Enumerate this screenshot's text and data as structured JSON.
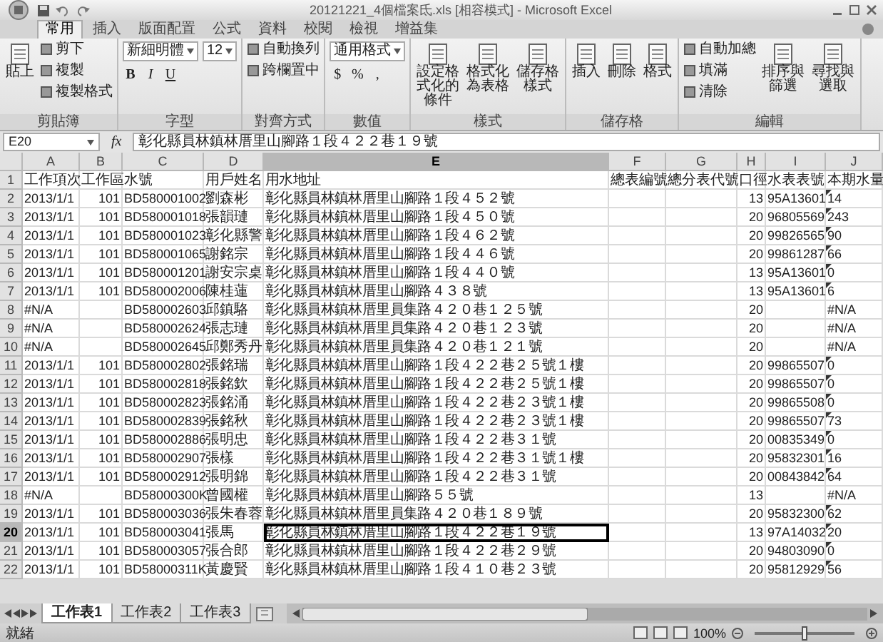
{
  "window": {
    "title": "20121221_4個檔案氐.xls [相容模式] - Microsoft Excel"
  },
  "ribbon_tabs": [
    {
      "label": "常用",
      "selected": true
    },
    {
      "label": "插入",
      "selected": false
    },
    {
      "label": "版面配置",
      "selected": false
    },
    {
      "label": "公式",
      "selected": false
    },
    {
      "label": "資料",
      "selected": false
    },
    {
      "label": "校閱",
      "selected": false
    },
    {
      "label": "檢視",
      "selected": false
    },
    {
      "label": "增益集",
      "selected": false
    }
  ],
  "ribbon_groups": [
    {
      "label": "剪貼簿",
      "parts": [
        {
          "kind": "large",
          "label": "貼上"
        },
        {
          "kind": "stack",
          "lines": [
            [
              {
                "kind": "small",
                "label": "剪下"
              }
            ],
            [
              {
                "kind": "small",
                "label": "複製"
              }
            ],
            [
              {
                "kind": "small",
                "label": "複製格式"
              }
            ]
          ]
        }
      ]
    },
    {
      "label": "字型",
      "parts": [
        {
          "kind": "stack",
          "lines": [
            [
              {
                "kind": "dropdown",
                "label": "新細明體"
              },
              {
                "kind": "dropdown",
                "label": "12"
              }
            ],
            [
              {
                "kind": "char",
                "label": "B"
              },
              {
                "kind": "char",
                "label": "I"
              },
              {
                "kind": "char",
                "label": "U"
              }
            ]
          ]
        }
      ]
    },
    {
      "label": "對齊方式",
      "parts": [
        {
          "kind": "stack",
          "lines": [
            [
              {
                "kind": "small",
                "label": "自動換列"
              }
            ],
            [
              {
                "kind": "small",
                "label": "跨欄置中"
              }
            ]
          ]
        }
      ]
    },
    {
      "label": "數值",
      "parts": [
        {
          "kind": "stack",
          "lines": [
            [
              {
                "kind": "dropdown",
                "label": "通用格式"
              }
            ],
            [
              {
                "kind": "char",
                "label": "$"
              },
              {
                "kind": "char",
                "label": "%"
              },
              {
                "kind": "char",
                "label": ","
              }
            ]
          ]
        }
      ]
    },
    {
      "label": "樣式",
      "parts": [
        {
          "kind": "large",
          "label": "設定格式化的條件"
        },
        {
          "kind": "large",
          "label": "格式化為表格"
        },
        {
          "kind": "large",
          "label": "儲存格樣式"
        }
      ]
    },
    {
      "label": "儲存格",
      "parts": [
        {
          "kind": "large",
          "label": "插入"
        },
        {
          "kind": "large",
          "label": "刪除"
        },
        {
          "kind": "large",
          "label": "格式"
        }
      ]
    },
    {
      "label": "編輯",
      "parts": [
        {
          "kind": "stack",
          "lines": [
            [
              {
                "kind": "small",
                "label": "自動加總"
              }
            ],
            [
              {
                "kind": "small",
                "label": "填滿"
              }
            ],
            [
              {
                "kind": "small",
                "label": "清除"
              }
            ]
          ]
        },
        {
          "kind": "large",
          "label": "排序與篩選"
        },
        {
          "kind": "large",
          "label": "尋找與選取"
        }
      ]
    }
  ],
  "formula_bar": {
    "name_box": "E20",
    "fx": "fx",
    "value": "彰化縣員林鎮林厝里山腳路１段４２２巷１９號"
  },
  "grid": {
    "columns": [
      {
        "label": "A",
        "selected": false
      },
      {
        "label": "B",
        "selected": false
      },
      {
        "label": "C",
        "selected": false
      },
      {
        "label": "D",
        "selected": false
      },
      {
        "label": "E",
        "selected": true
      },
      {
        "label": "F",
        "selected": false
      },
      {
        "label": "G",
        "selected": false
      },
      {
        "label": "H",
        "selected": false
      },
      {
        "label": "I",
        "selected": false
      },
      {
        "label": "J",
        "selected": false
      }
    ],
    "rows": [
      {
        "number": "1",
        "selected": false,
        "flag": false,
        "cells": {
          "A": "工作項次",
          "B": "工作區",
          "C": "水號",
          "D": "用戶姓名",
          "E": "用水地址",
          "F": "總表編號",
          "G": "總分表代號",
          "H": "口徑",
          "I": "水表表號",
          "J": "本期水量"
        }
      },
      {
        "number": "2",
        "selected": false,
        "flag": true,
        "cells": {
          "A": "2013/1/1",
          "B": "101",
          "C": "BD580001002",
          "D": "劉森彬",
          "E": "彰化縣員林鎮林厝里山腳路１段４５２號",
          "H": "13",
          "I": "95A13601",
          "J": "14"
        }
      },
      {
        "number": "3",
        "selected": false,
        "flag": true,
        "cells": {
          "A": "2013/1/1",
          "B": "101",
          "C": "BD580001018",
          "D": "張韻璉",
          "E": "彰化縣員林鎮林厝里山腳路１段４５０號",
          "H": "20",
          "I": "96805569",
          "J": "243"
        }
      },
      {
        "number": "4",
        "selected": false,
        "flag": true,
        "cells": {
          "A": "2013/1/1",
          "B": "101",
          "C": "BD580001023",
          "D": "彰化縣警",
          "E": "彰化縣員林鎮林厝里山腳路１段４６２號",
          "H": "20",
          "I": "99826565",
          "J": "90"
        }
      },
      {
        "number": "5",
        "selected": false,
        "flag": true,
        "cells": {
          "A": "2013/1/1",
          "B": "101",
          "C": "BD580001065",
          "D": "謝銘宗",
          "E": "彰化縣員林鎮林厝里山腳路１段４４６號",
          "H": "20",
          "I": "99861287",
          "J": "66"
        }
      },
      {
        "number": "6",
        "selected": false,
        "flag": true,
        "cells": {
          "A": "2013/1/1",
          "B": "101",
          "C": "BD580001201",
          "D": "謝安宗桌",
          "E": "彰化縣員林鎮林厝里山腳路１段４４０號",
          "H": "13",
          "I": "95A13601",
          "J": "0"
        }
      },
      {
        "number": "7",
        "selected": false,
        "flag": true,
        "cells": {
          "A": "2013/1/1",
          "B": "101",
          "C": "BD580002006",
          "D": "陳桂蓮",
          "E": "彰化縣員林鎮林厝里山腳路４３８號",
          "H": "13",
          "I": "95A13601",
          "J": "6"
        }
      },
      {
        "number": "8",
        "selected": false,
        "flag": false,
        "cells": {
          "A": "#N/A",
          "C": "BD580002603",
          "D": "邱鎮駱",
          "E": "彰化縣員林鎮林厝里員集路４２０巷１２５號",
          "H": "20",
          "J": "#N/A"
        }
      },
      {
        "number": "9",
        "selected": false,
        "flag": false,
        "cells": {
          "A": "#N/A",
          "C": "BD580002624",
          "D": "張志璉",
          "E": "彰化縣員林鎮林厝里員集路４２０巷１２３號",
          "H": "20",
          "J": "#N/A"
        }
      },
      {
        "number": "10",
        "selected": false,
        "flag": false,
        "cells": {
          "A": "#N/A",
          "C": "BD580002645",
          "D": "邱鄭秀丹",
          "E": "彰化縣員林鎮林厝里員集路４２０巷１２１號",
          "H": "20",
          "J": "#N/A"
        }
      },
      {
        "number": "11",
        "selected": false,
        "flag": true,
        "cells": {
          "A": "2013/1/1",
          "B": "101",
          "C": "BD580002802",
          "D": "張銘瑞",
          "E": "彰化縣員林鎮林厝里山腳路１段４２２巷２５號１樓",
          "H": "20",
          "I": "99865507",
          "J": "0"
        }
      },
      {
        "number": "12",
        "selected": false,
        "flag": true,
        "cells": {
          "A": "2013/1/1",
          "B": "101",
          "C": "BD580002818",
          "D": "張銘欽",
          "E": "彰化縣員林鎮林厝里山腳路１段４２２巷２５號１樓",
          "H": "20",
          "I": "99865507",
          "J": "0"
        }
      },
      {
        "number": "13",
        "selected": false,
        "flag": true,
        "cells": {
          "A": "2013/1/1",
          "B": "101",
          "C": "BD580002823",
          "D": "張銘涌",
          "E": "彰化縣員林鎮林厝里山腳路１段４２２巷２３號１樓",
          "H": "20",
          "I": "99865508",
          "J": "0"
        }
      },
      {
        "number": "14",
        "selected": false,
        "flag": true,
        "cells": {
          "A": "2013/1/1",
          "B": "101",
          "C": "BD580002839",
          "D": "張銘秋",
          "E": "彰化縣員林鎮林厝里山腳路１段４２２巷２３號１樓",
          "H": "20",
          "I": "99865507",
          "J": "73"
        }
      },
      {
        "number": "15",
        "selected": false,
        "flag": true,
        "cells": {
          "A": "2013/1/1",
          "B": "101",
          "C": "BD580002886",
          "D": "張明忠",
          "E": "彰化縣員林鎮林厝里山腳路１段４２２巷３１號",
          "H": "20",
          "I": "00835349",
          "J": "0"
        }
      },
      {
        "number": "16",
        "selected": false,
        "flag": true,
        "cells": {
          "A": "2013/1/1",
          "B": "101",
          "C": "BD580002907",
          "D": "張樣",
          "E": "彰化縣員林鎮林厝里山腳路１段４２２巷３１號１樓",
          "H": "20",
          "I": "95832301",
          "J": "16"
        }
      },
      {
        "number": "17",
        "selected": false,
        "flag": true,
        "cells": {
          "A": "2013/1/1",
          "B": "101",
          "C": "BD580002912",
          "D": "張明錦",
          "E": "彰化縣員林鎮林厝里山腳路１段４２２巷３１號",
          "H": "20",
          "I": "00843842",
          "J": "64"
        }
      },
      {
        "number": "18",
        "selected": false,
        "flag": false,
        "cells": {
          "A": "#N/A",
          "C": "BD58000300K",
          "D": "曾國權",
          "E": "彰化縣員林鎮林厝里山腳路５５號",
          "H": "13",
          "J": "#N/A"
        }
      },
      {
        "number": "19",
        "selected": false,
        "flag": true,
        "cells": {
          "A": "2013/1/1",
          "B": "101",
          "C": "BD580003036",
          "D": "張朱春蓉",
          "E": "彰化縣員林鎮林厝里員集路４２０巷１８９號",
          "H": "20",
          "I": "95832300",
          "J": "62"
        }
      },
      {
        "number": "20",
        "selected": true,
        "flag": true,
        "cells": {
          "A": "2013/1/1",
          "B": "101",
          "C": "BD580003041",
          "D": "張馬",
          "E": "彰化縣員林鎮林厝里山腳路１段４２２巷１９號",
          "H": "13",
          "I": "97A14032",
          "J": "20"
        }
      },
      {
        "number": "21",
        "selected": false,
        "flag": true,
        "cells": {
          "A": "2013/1/1",
          "B": "101",
          "C": "BD580003057",
          "D": "張合郎",
          "E": "彰化縣員林鎮林厝里山腳路１段４２２巷２９號",
          "H": "20",
          "I": "94803090",
          "J": "0"
        }
      },
      {
        "number": "22",
        "selected": false,
        "flag": true,
        "cells": {
          "A": "2013/1/1",
          "B": "101",
          "C": "BD58000311K",
          "D": "黃慶賢",
          "E": "彰化縣員林鎮林厝里山腳路１段４１０巷２３號",
          "H": "20",
          "I": "95812929",
          "J": "56"
        }
      }
    ]
  },
  "sheet_tabs": [
    {
      "label": "工作表1",
      "selected": true
    },
    {
      "label": "工作表2",
      "selected": false
    },
    {
      "label": "工作表3",
      "selected": false
    }
  ],
  "status_bar": {
    "status": "就緒",
    "zoom": "100%",
    "zoom_slider": {
      "level": 0.5
    }
  }
}
